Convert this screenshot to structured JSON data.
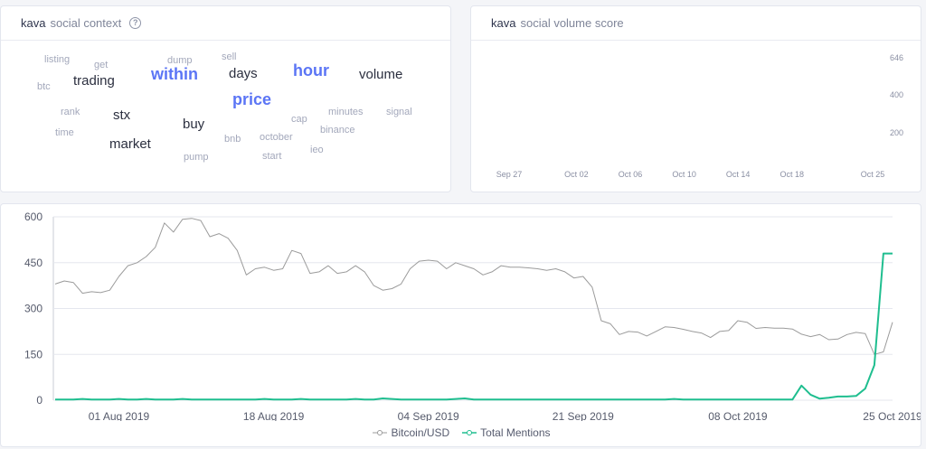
{
  "context_card": {
    "ticker": "kava",
    "title": "social context",
    "words": [
      {
        "text": "listing",
        "weight": 1
      },
      {
        "text": "get",
        "weight": 1
      },
      {
        "text": "dump",
        "weight": 1
      },
      {
        "text": "sell",
        "weight": 1
      },
      {
        "text": "btc",
        "weight": 1
      },
      {
        "text": "trading",
        "weight": 3
      },
      {
        "text": "within",
        "weight": 5
      },
      {
        "text": "days",
        "weight": 3
      },
      {
        "text": "hour",
        "weight": 5
      },
      {
        "text": "volume",
        "weight": 3
      },
      {
        "text": "price",
        "weight": 5
      },
      {
        "text": "rank",
        "weight": 1
      },
      {
        "text": "stx",
        "weight": 3
      },
      {
        "text": "cap",
        "weight": 1
      },
      {
        "text": "minutes",
        "weight": 1
      },
      {
        "text": "signal",
        "weight": 1
      },
      {
        "text": "time",
        "weight": 1
      },
      {
        "text": "buy",
        "weight": 3
      },
      {
        "text": "binance",
        "weight": 1
      },
      {
        "text": "bnb",
        "weight": 1
      },
      {
        "text": "october",
        "weight": 1
      },
      {
        "text": "market",
        "weight": 3
      },
      {
        "text": "ieo",
        "weight": 1
      },
      {
        "text": "pump",
        "weight": 1
      },
      {
        "text": "start",
        "weight": 1
      }
    ]
  },
  "volume_card": {
    "ticker": "kava",
    "title": "social volume score"
  },
  "colors": {
    "bitcoin": "#9b9b9b",
    "mentions": "#1fbe8f",
    "accent_word": "#5b75f5",
    "bars": "#dde2ee"
  },
  "chart_data": [
    {
      "type": "bar",
      "categories": [
        "Sep 27",
        "",
        "",
        "",
        "",
        "Oct 02",
        "",
        "",
        "",
        "Oct 06",
        "",
        "",
        "",
        "Oct 10",
        "",
        "",
        "",
        "Oct 14",
        "",
        "",
        "",
        "Oct 18",
        "",
        "",
        "",
        "",
        "",
        "Oct 25"
      ],
      "values": [
        0,
        0,
        0,
        0,
        0,
        0,
        0,
        0,
        0,
        0,
        0,
        0,
        0,
        0,
        0,
        0,
        0,
        0,
        0,
        0,
        0,
        0,
        0,
        0,
        0,
        0,
        0,
        0
      ],
      "x_tick_labels": [
        "Sep 27",
        "Oct 02",
        "Oct 06",
        "Oct 10",
        "Oct 14",
        "Oct 18",
        "Oct 25"
      ],
      "y_tick_labels": [
        "200",
        "400",
        "646"
      ],
      "ylim": [
        0,
        646
      ],
      "grid": false
    },
    {
      "type": "line",
      "x": [
        "2019-07-25",
        "2019-07-26",
        "2019-07-27",
        "2019-07-28",
        "2019-07-29",
        "2019-07-30",
        "2019-07-31",
        "2019-08-01",
        "2019-08-02",
        "2019-08-03",
        "2019-08-04",
        "2019-08-05",
        "2019-08-06",
        "2019-08-07",
        "2019-08-08",
        "2019-08-09",
        "2019-08-10",
        "2019-08-11",
        "2019-08-12",
        "2019-08-13",
        "2019-08-14",
        "2019-08-15",
        "2019-08-16",
        "2019-08-17",
        "2019-08-18",
        "2019-08-19",
        "2019-08-20",
        "2019-08-21",
        "2019-08-22",
        "2019-08-23",
        "2019-08-24",
        "2019-08-25",
        "2019-08-26",
        "2019-08-27",
        "2019-08-28",
        "2019-08-29",
        "2019-08-30",
        "2019-08-31",
        "2019-09-01",
        "2019-09-02",
        "2019-09-03",
        "2019-09-04",
        "2019-09-05",
        "2019-09-06",
        "2019-09-07",
        "2019-09-08",
        "2019-09-09",
        "2019-09-10",
        "2019-09-11",
        "2019-09-12",
        "2019-09-13",
        "2019-09-14",
        "2019-09-15",
        "2019-09-16",
        "2019-09-17",
        "2019-09-18",
        "2019-09-19",
        "2019-09-20",
        "2019-09-21",
        "2019-09-22",
        "2019-09-23",
        "2019-09-24",
        "2019-09-25",
        "2019-09-26",
        "2019-09-27",
        "2019-09-28",
        "2019-09-29",
        "2019-09-30",
        "2019-10-01",
        "2019-10-02",
        "2019-10-03",
        "2019-10-04",
        "2019-10-05",
        "2019-10-06",
        "2019-10-07",
        "2019-10-08",
        "2019-10-09",
        "2019-10-10",
        "2019-10-11",
        "2019-10-12",
        "2019-10-13",
        "2019-10-14",
        "2019-10-15",
        "2019-10-16",
        "2019-10-17",
        "2019-10-18",
        "2019-10-19",
        "2019-10-20",
        "2019-10-21",
        "2019-10-22",
        "2019-10-23",
        "2019-10-24",
        "2019-10-25"
      ],
      "x_tick_labels": [
        "01 Aug 2019",
        "18 Aug 2019",
        "04 Sep 2019",
        "21 Sep 2019",
        "08 Oct 2019",
        "25 Oct 2019"
      ],
      "y_tick_labels": [
        "0",
        "150",
        "300",
        "450",
        "600"
      ],
      "ylim": [
        0,
        600
      ],
      "grid": true,
      "legend_placement": "bottom-center",
      "series": [
        {
          "name": "Bitcoin/USD",
          "values": [
            380,
            390,
            385,
            350,
            355,
            352,
            360,
            405,
            440,
            450,
            470,
            500,
            580,
            550,
            592,
            595,
            588,
            535,
            545,
            530,
            490,
            410,
            430,
            435,
            425,
            430,
            490,
            480,
            415,
            420,
            440,
            415,
            420,
            440,
            420,
            375,
            360,
            365,
            380,
            430,
            455,
            458,
            455,
            430,
            450,
            440,
            430,
            410,
            420,
            440,
            435,
            435,
            433,
            430,
            425,
            430,
            420,
            400,
            405,
            370,
            260,
            250,
            215,
            225,
            223,
            210,
            225,
            240,
            238,
            232,
            225,
            220,
            205,
            225,
            228,
            260,
            255,
            235,
            238,
            236,
            236,
            233,
            216,
            208,
            215,
            198,
            200,
            215,
            222,
            218,
            150,
            158,
            255
          ]
        },
        {
          "name": "Total Mentions",
          "values": [
            2,
            2,
            2,
            4,
            2,
            2,
            2,
            4,
            2,
            2,
            4,
            2,
            2,
            2,
            4,
            2,
            2,
            2,
            2,
            2,
            2,
            2,
            2,
            4,
            2,
            2,
            2,
            4,
            2,
            2,
            2,
            2,
            2,
            4,
            2,
            2,
            6,
            4,
            2,
            2,
            2,
            2,
            2,
            2,
            4,
            6,
            2,
            2,
            2,
            2,
            2,
            2,
            2,
            2,
            2,
            2,
            2,
            2,
            2,
            2,
            2,
            2,
            2,
            2,
            2,
            2,
            2,
            2,
            4,
            2,
            2,
            2,
            2,
            2,
            2,
            2,
            2,
            2,
            2,
            2,
            2,
            2,
            48,
            18,
            5,
            8,
            12,
            12,
            14,
            38,
            115,
            480,
            480
          ]
        }
      ]
    }
  ]
}
